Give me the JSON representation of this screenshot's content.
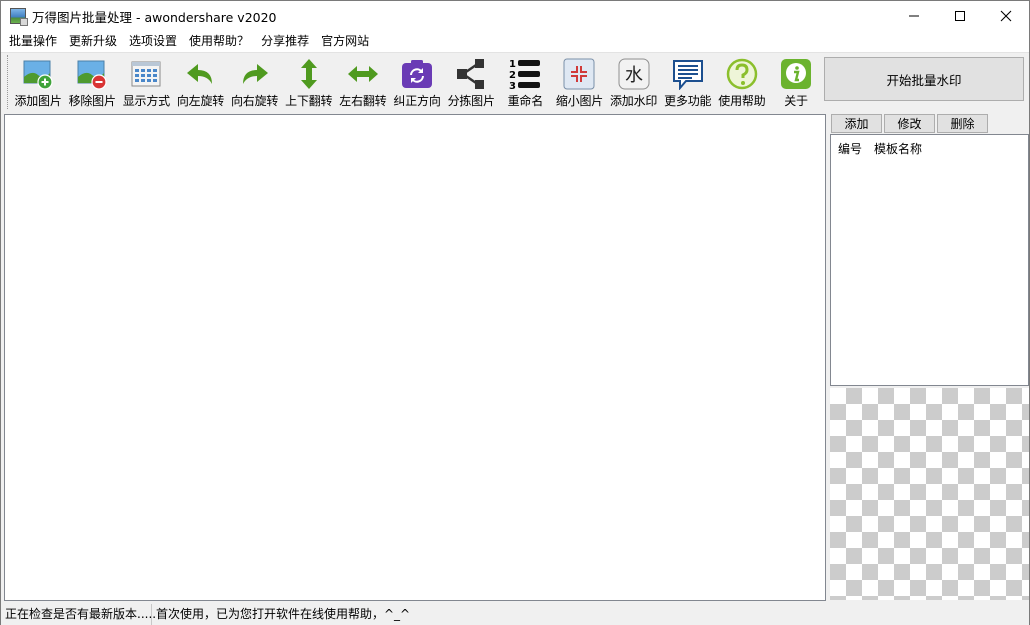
{
  "window": {
    "title": "万得图片批量处理 - awondershare v2020"
  },
  "menu": [
    "批量操作",
    "更新升级",
    "选项设置",
    "使用帮助？",
    "分享推荐",
    "官方网站"
  ],
  "toolbar": {
    "items": [
      {
        "label": "添加图片",
        "icon": "add-image-icon"
      },
      {
        "label": "移除图片",
        "icon": "remove-image-icon"
      },
      {
        "label": "显示方式",
        "icon": "view-mode-icon"
      },
      {
        "label": "向左旋转",
        "icon": "rotate-left-icon"
      },
      {
        "label": "向右旋转",
        "icon": "rotate-right-icon"
      },
      {
        "label": "上下翻转",
        "icon": "flip-vertical-icon"
      },
      {
        "label": "左右翻转",
        "icon": "flip-horizontal-icon"
      },
      {
        "label": "纠正方向",
        "icon": "correct-orientation-icon"
      },
      {
        "label": "分拣图片",
        "icon": "sort-images-icon"
      },
      {
        "label": "重命名",
        "icon": "rename-icon"
      },
      {
        "label": "缩小图片",
        "icon": "shrink-image-icon"
      },
      {
        "label": "添加水印",
        "icon": "add-watermark-icon"
      },
      {
        "label": "更多功能",
        "icon": "more-features-icon"
      },
      {
        "label": "使用帮助",
        "icon": "help-icon"
      },
      {
        "label": "关于",
        "icon": "about-icon"
      }
    ],
    "watermark_glyph": "水",
    "rename_digits": [
      "1",
      "2",
      "3"
    ]
  },
  "start_button": "开始批量水印",
  "templates": {
    "add": "添加",
    "edit": "修改",
    "delete": "删除",
    "columns": [
      "编号",
      "模板名称"
    ]
  },
  "status": {
    "left": "正在检查是否有最新版本.....",
    "right": "首次使用，已为您打开软件在线使用帮助，^_^"
  },
  "colors": {
    "green_arrow": "#4f9a1f",
    "purple": "#6a3bb5",
    "title_bg": "#ffffff",
    "window_bg": "#f0f0f0"
  }
}
